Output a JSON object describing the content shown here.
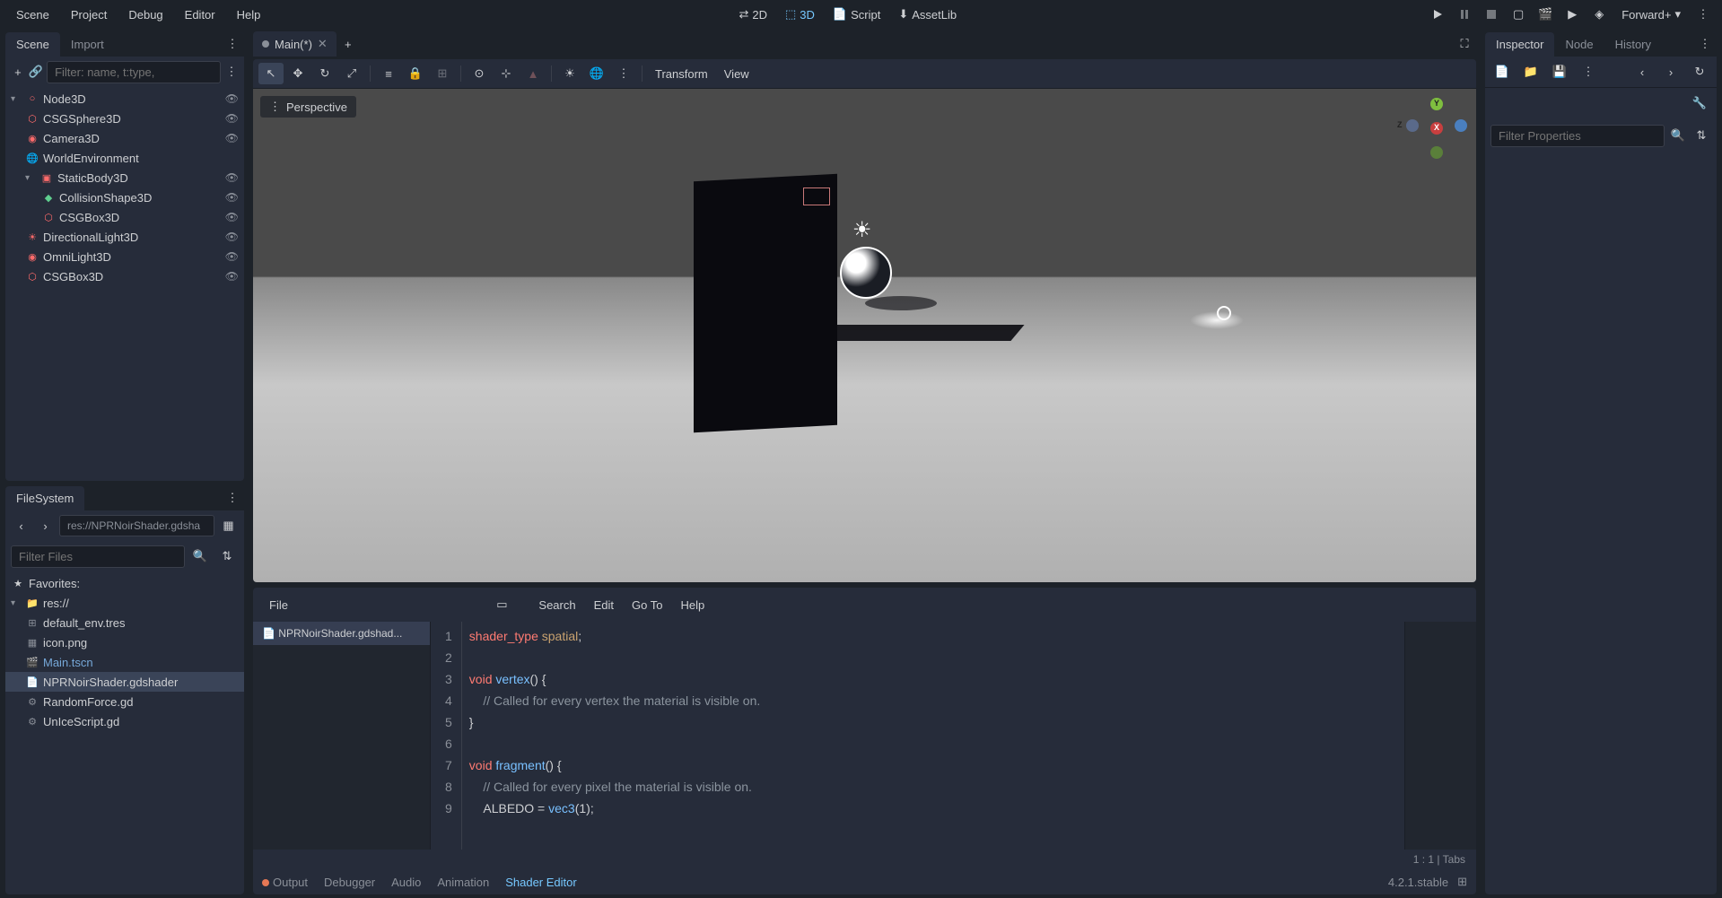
{
  "menubar": {
    "scene": "Scene",
    "project": "Project",
    "debug": "Debug",
    "editor": "Editor",
    "help": "Help"
  },
  "topcenter": {
    "mode_2d": "2D",
    "mode_3d": "3D",
    "script": "Script",
    "assetlib": "AssetLib"
  },
  "topright": {
    "renderer": "Forward+"
  },
  "scene_panel": {
    "tab_scene": "Scene",
    "tab_import": "Import",
    "filter_placeholder": "Filter: name, t:type,",
    "root": "Node3D",
    "items": [
      {
        "label": "CSGSphere3D"
      },
      {
        "label": "Camera3D"
      },
      {
        "label": "WorldEnvironment"
      },
      {
        "label": "StaticBody3D"
      },
      {
        "label": "CollisionShape3D"
      },
      {
        "label": "CSGBox3D"
      },
      {
        "label": "DirectionalLight3D"
      },
      {
        "label": "OmniLight3D"
      },
      {
        "label": "CSGBox3D"
      }
    ]
  },
  "fs_panel": {
    "tab": "FileSystem",
    "path": "res://NPRNoirShader.gdsha",
    "filter_placeholder": "Filter Files",
    "favorites": "Favorites:",
    "root": "res://",
    "files": [
      {
        "label": "default_env.tres"
      },
      {
        "label": "icon.png"
      },
      {
        "label": "Main.tscn"
      },
      {
        "label": "NPRNoirShader.gdshader"
      },
      {
        "label": "RandomForce.gd"
      },
      {
        "label": "UnIceScript.gd"
      }
    ]
  },
  "center": {
    "tab_name": "Main(*)",
    "perspective": "Perspective",
    "transform": "Transform",
    "view": "View",
    "gizmo": {
      "x": "X",
      "y": "Y",
      "z": "Z"
    }
  },
  "shader_editor": {
    "file": "File",
    "search": "Search",
    "edit": "Edit",
    "goto": "Go To",
    "help": "Help",
    "file_tab": "NPRNoirShader.gdshad...",
    "lines": [
      "1",
      "2",
      "3",
      "4",
      "5",
      "6",
      "7",
      "8",
      "9"
    ],
    "status": "1 :      1  |  Tabs"
  },
  "bottom_tabs": {
    "output": "Output",
    "debugger": "Debugger",
    "audio": "Audio",
    "animation": "Animation",
    "shader_editor": "Shader Editor",
    "version": "4.2.1.stable"
  },
  "inspector": {
    "tab_inspector": "Inspector",
    "tab_node": "Node",
    "tab_history": "History",
    "filter_placeholder": "Filter Properties"
  },
  "chart_data": {
    "type": "code",
    "language": "gdshader",
    "content": "shader_type spatial;\n\nvoid vertex() {\n    // Called for every vertex the material is visible on.\n}\n\nvoid fragment() {\n    // Called for every pixel the material is visible on.\n    ALBEDO = vec3(1);"
  }
}
